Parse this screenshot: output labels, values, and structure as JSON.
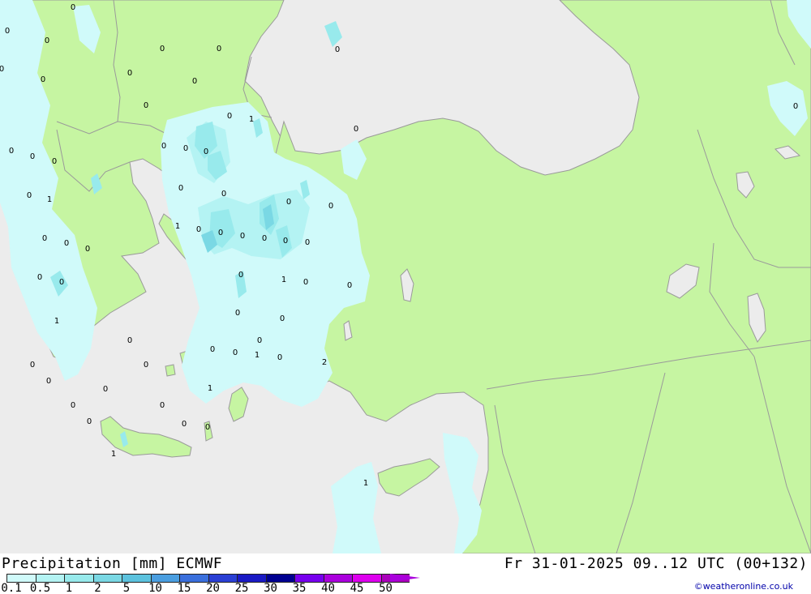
{
  "title": {
    "left": "Precipitation [mm] ECMWF",
    "right": "Fr 31-01-2025 09..12 UTC (00+132)"
  },
  "credit": "©weatheronline.co.uk",
  "colors": {
    "sea": "#ececec",
    "land_dry": "#c6f5a2",
    "border": "#9a9a9a",
    "credit": "#0000aa"
  },
  "legend": {
    "ticks": [
      "0.1",
      "0.5",
      "1",
      "2",
      "5",
      "10",
      "15",
      "20",
      "25",
      "30",
      "35",
      "40",
      "45",
      "50"
    ],
    "colors": [
      "#d0fafa",
      "#b4f3f3",
      "#98eaec",
      "#7ad8e4",
      "#5cc2de",
      "#4a9ee0",
      "#3a6fdc",
      "#2a3fd4",
      "#1a1ac4",
      "#000090",
      "#7700ee",
      "#aa00dd",
      "#dd00ee",
      "#aa00bb"
    ]
  },
  "map_values": [
    "0",
    "0",
    "0",
    "0",
    "0",
    "0",
    "0",
    "1",
    "0",
    "0",
    "0",
    "0",
    "0",
    "0",
    "0",
    "0",
    "0",
    "0",
    "1",
    "0",
    "0",
    "0",
    "1",
    "0",
    "0",
    "0",
    "0",
    "0",
    "0",
    "0",
    "0",
    "0",
    "0",
    "0",
    "0",
    "1",
    "0",
    "0",
    "0",
    "0",
    "1",
    "0",
    "0",
    "1",
    "0",
    "2",
    "1",
    "0",
    "0",
    "1",
    "0",
    "1",
    "0",
    "0",
    "0",
    "0",
    "0",
    "0",
    "0",
    "0",
    "0",
    "0",
    "0",
    "0",
    "0"
  ]
}
